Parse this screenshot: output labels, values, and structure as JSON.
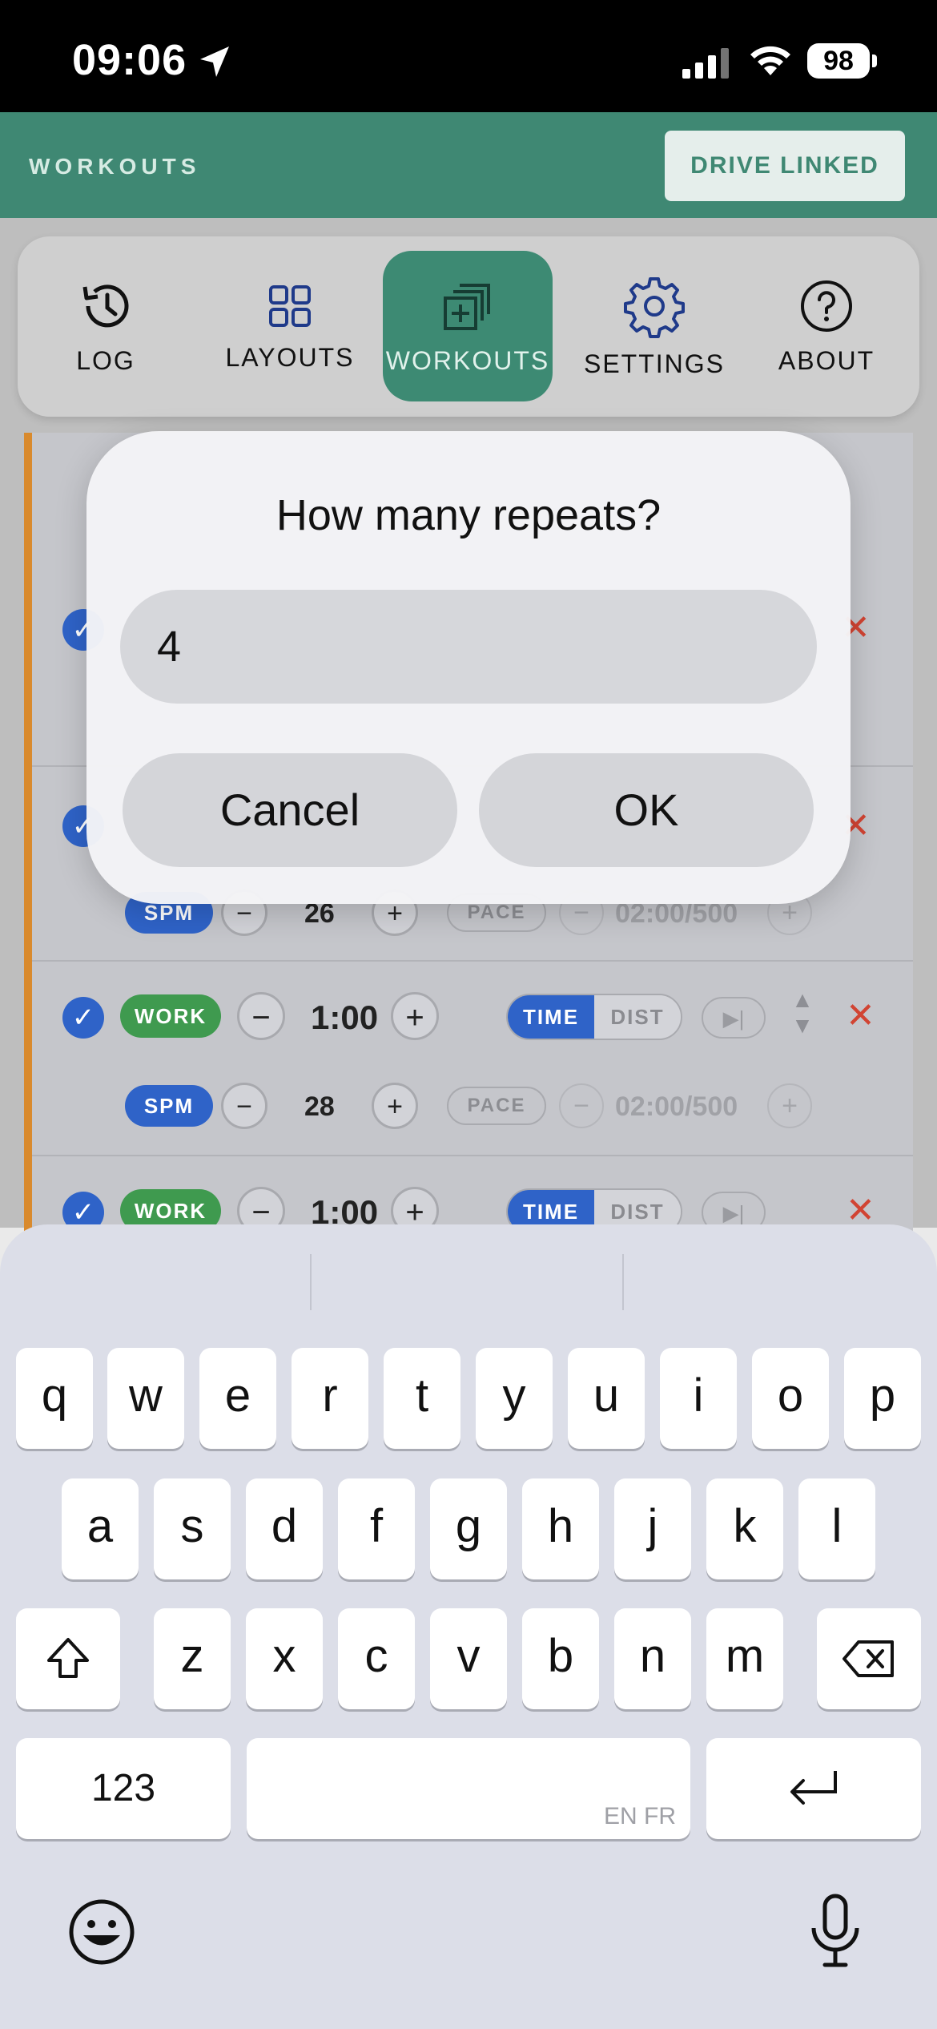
{
  "status_bar": {
    "time": "09:06",
    "battery": "98"
  },
  "app_header": {
    "title": "WORKOUTS",
    "drive_button": "DRIVE LINKED"
  },
  "tabs": [
    {
      "label": "LOG",
      "icon": "history-icon",
      "active": false
    },
    {
      "label": "LAYOUTS",
      "icon": "grid-icon",
      "active": false
    },
    {
      "label": "WORKOUTS",
      "icon": "stack-add-icon",
      "active": true
    },
    {
      "label": "SETTINGS",
      "icon": "gear-icon",
      "active": false
    },
    {
      "label": "ABOUT",
      "icon": "help-icon",
      "active": false
    }
  ],
  "workout_rows": [
    {
      "type": "WORK",
      "duration": "1:00",
      "time_label": "TIME",
      "dist_label": "DIST",
      "spm_label": "SPM",
      "spm": "26",
      "pace_label": "PACE",
      "pace": "02:00/500"
    },
    {
      "type": "WORK",
      "duration": "1:00",
      "time_label": "TIME",
      "dist_label": "DIST",
      "spm_label": "SPM",
      "spm": "28",
      "pace_label": "PACE",
      "pace": "02:00/500"
    },
    {
      "type": "WORK",
      "duration": "1:00",
      "time_label": "TIME",
      "dist_label": "DIST"
    }
  ],
  "dialog": {
    "title": "How many repeats?",
    "input_value": "4",
    "cancel_label": "Cancel",
    "ok_label": "OK"
  },
  "keyboard": {
    "row1": [
      "q",
      "w",
      "e",
      "r",
      "t",
      "y",
      "u",
      "i",
      "o",
      "p"
    ],
    "row2": [
      "a",
      "s",
      "d",
      "f",
      "g",
      "h",
      "j",
      "k",
      "l"
    ],
    "row3": [
      "z",
      "x",
      "c",
      "v",
      "b",
      "n",
      "m"
    ],
    "numbers_key": "123",
    "space_hint": "EN FR"
  }
}
